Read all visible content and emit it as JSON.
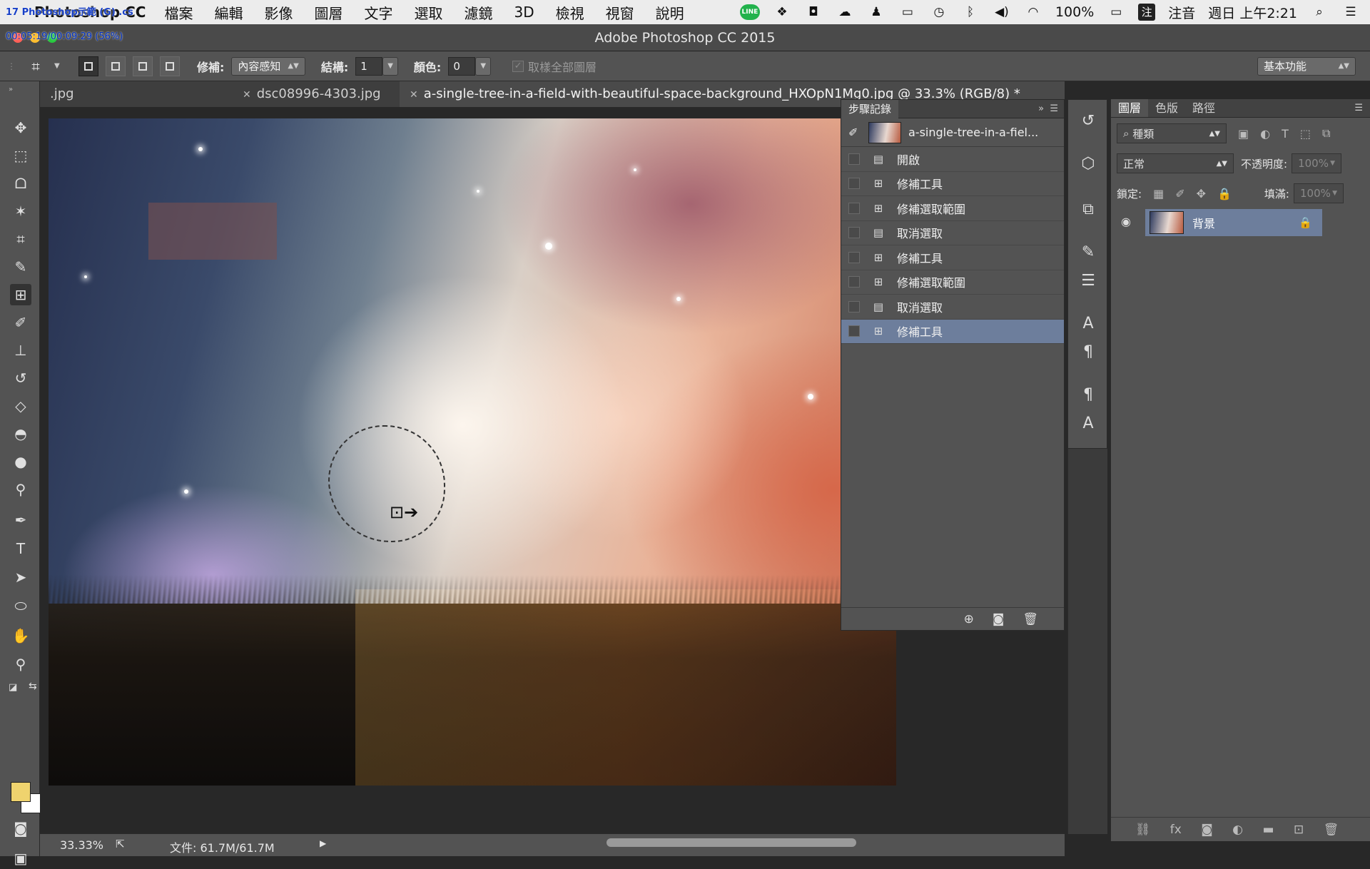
{
  "menubar": {
    "app_name": "Photoshop CC",
    "menus": [
      "檔案",
      "編輯",
      "影像",
      "圖層",
      "文字",
      "選取",
      "濾鏡",
      "3D",
      "檢視",
      "視窗",
      "說明"
    ],
    "battery": "100%",
    "input_method": "注音",
    "clock": "週日 上午2:21"
  },
  "overlay": {
    "line1": "17 Photoshop示範 (G) .cs",
    "line2": "00:05:19/00:09:29 (56%)"
  },
  "window": {
    "title": "Adobe Photoshop CC 2015"
  },
  "options": {
    "patch_label": "修補:",
    "patch_value": "內容感知",
    "structure_label": "結構:",
    "structure_value": "1",
    "color_label": "顏色:",
    "color_value": "0",
    "sample_all_label": "取樣全部圖層",
    "workspace": "基本功能"
  },
  "tabs": [
    {
      "label": ".jpg"
    },
    {
      "label": "dsc08996-4303.jpg"
    },
    {
      "label": "a-single-tree-in-a-field-with-beautiful-space-background_HXOpN1Mg0.jpg @ 33.3% (RGB/8) *"
    }
  ],
  "history": {
    "title": "步驟記錄",
    "snapshot": "a-single-tree-in-a-fiel...",
    "items": [
      "開啟",
      "修補工具",
      "修補選取範圍",
      "取消選取",
      "修補工具",
      "修補選取範圍",
      "取消選取",
      "修補工具"
    ]
  },
  "layers": {
    "tabs": [
      "圖層",
      "色版",
      "路徑"
    ],
    "kind_filter": "種類",
    "blend_mode": "正常",
    "opacity_label": "不透明度:",
    "opacity_value": "100%",
    "lock_label": "鎖定:",
    "fill_label": "填滿:",
    "fill_value": "100%",
    "layer_name": "背景"
  },
  "status": {
    "zoom": "33.33%",
    "doc_size": "文件: 61.7M/61.7M"
  },
  "colors": {
    "foreground": "#efd36e",
    "background": "#ffffff",
    "selection": "#6d7e9c"
  }
}
